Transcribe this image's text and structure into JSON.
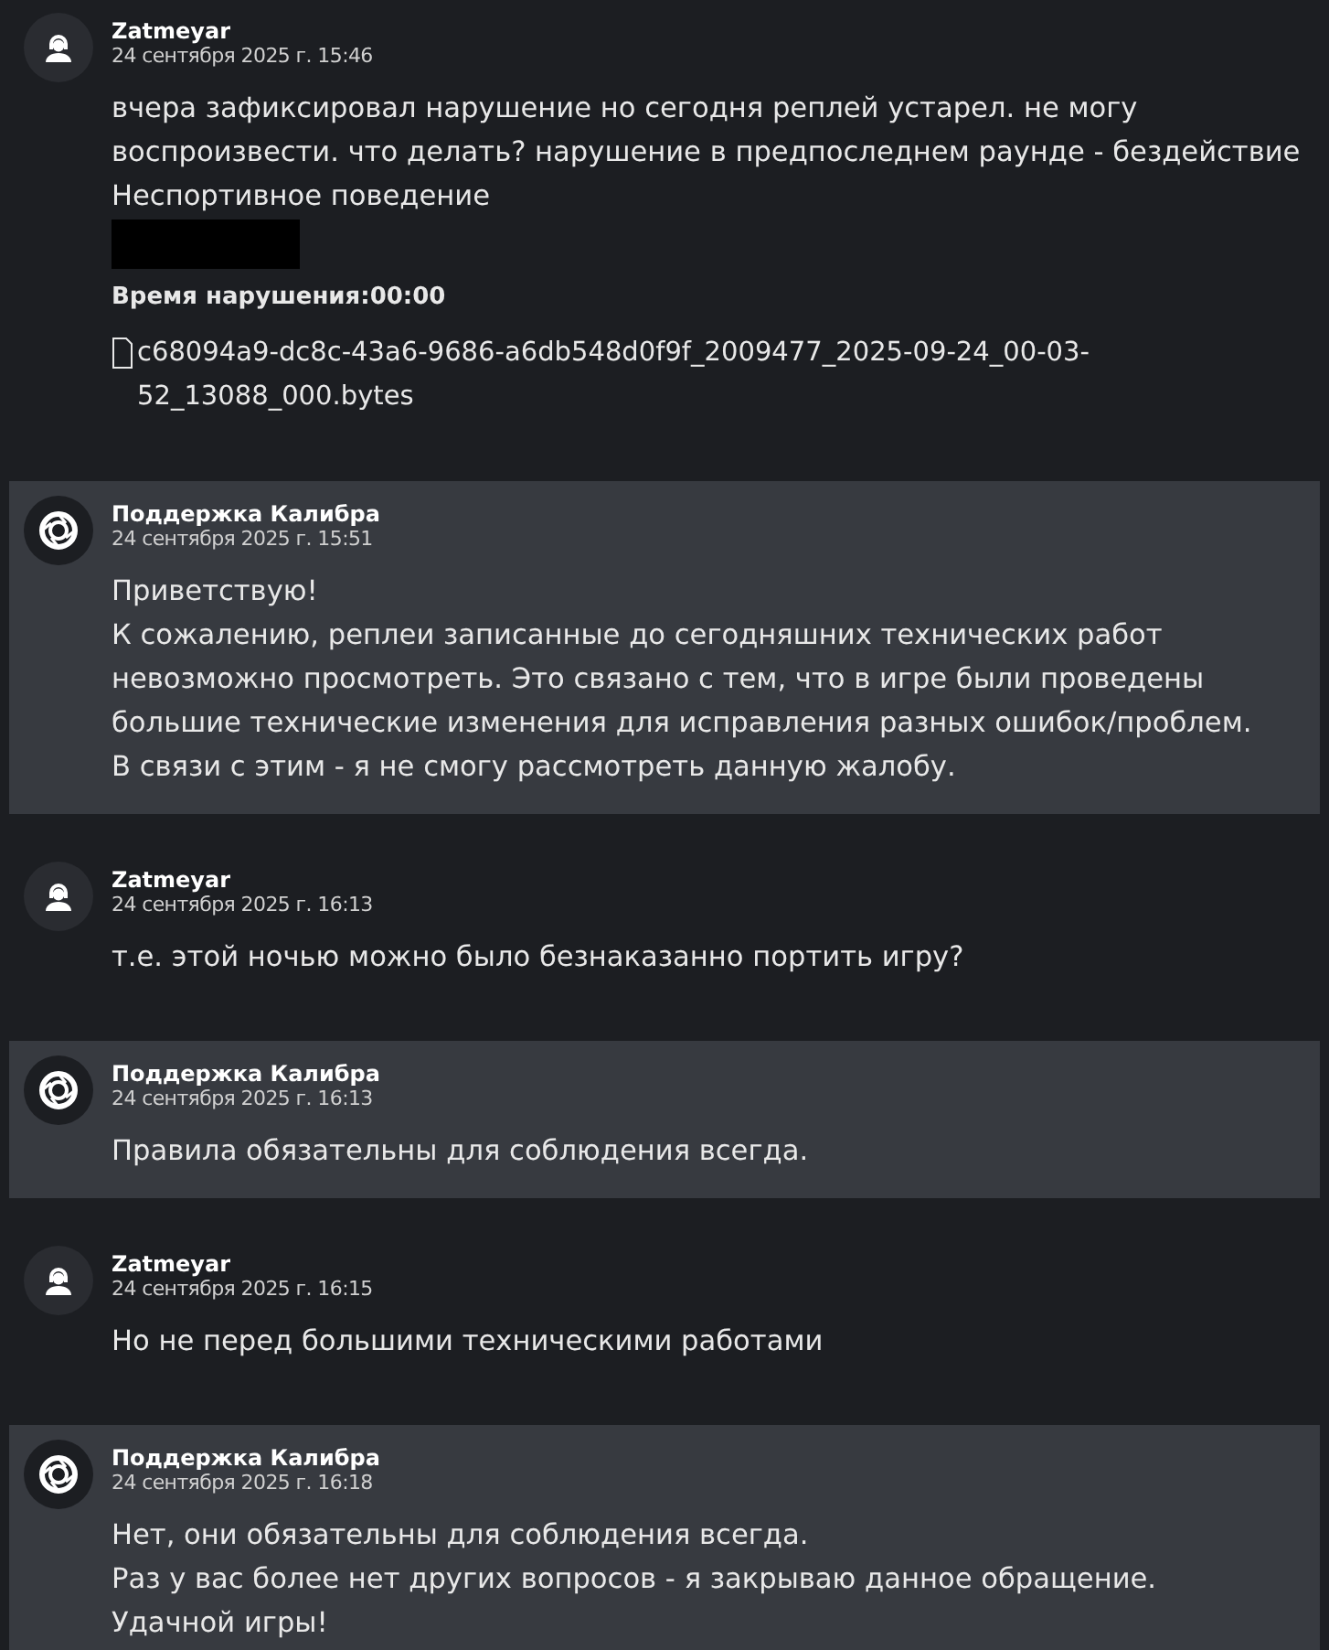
{
  "messages": [
    {
      "kind": "user",
      "author": "Zatmeyar",
      "time": "24 сентября 2025 г. 15:46",
      "lines": [
        "вчера зафиксировал нарушение но сегодня реплей устарел. не могу воспроизвести. что делать? нарушение в предпоследнем раунде - бездействие",
        "Неспортивное поведение"
      ],
      "redacted": true,
      "violation_time": "Время нарушения:00:00",
      "attachment": "c68094a9-dc8c-43a6-9686-a6db548d0f9f_2009477_2025-09-24_00-03-52_13088_000.bytes"
    },
    {
      "kind": "support",
      "author": "Поддержка Калибра",
      "time": "24 сентября 2025 г. 15:51",
      "lines": [
        "Приветствую!",
        "К сожалению, реплеи записанные до сегодняшних технических работ невозможно просмотреть. Это связано с тем, что в игре были проведены большие технические изменения для исправления разных ошибок/проблем.",
        "В связи с этим - я не смогу рассмотреть данную жалобу."
      ]
    },
    {
      "kind": "user",
      "author": "Zatmeyar",
      "time": "24 сентября 2025 г. 16:13",
      "lines": [
        "т.е. этой ночью можно было безнаказанно портить игру?"
      ]
    },
    {
      "kind": "support",
      "author": "Поддержка Калибра",
      "time": "24 сентября 2025 г. 16:13",
      "lines": [
        "Правила обязательны для соблюдения всегда."
      ]
    },
    {
      "kind": "user",
      "author": "Zatmeyar",
      "time": "24 сентября 2025 г. 16:15",
      "lines": [
        "Но не перед большими техническими работами"
      ]
    },
    {
      "kind": "support",
      "author": "Поддержка Калибра",
      "time": "24 сентября 2025 г. 16:18",
      "lines": [
        "Нет, они обязательны для соблюдения всегда.",
        "Раз у вас более нет других вопросов - я закрываю данное обращение.",
        "Удачной игры!"
      ]
    }
  ]
}
